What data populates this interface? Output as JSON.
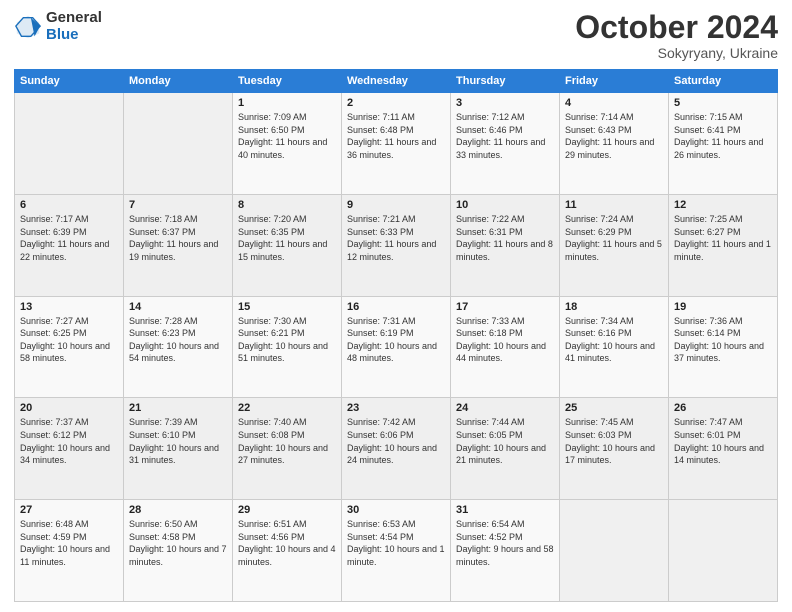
{
  "logo": {
    "general": "General",
    "blue": "Blue"
  },
  "header": {
    "month": "October 2024",
    "location": "Sokyryany, Ukraine"
  },
  "weekdays": [
    "Sunday",
    "Monday",
    "Tuesday",
    "Wednesday",
    "Thursday",
    "Friday",
    "Saturday"
  ],
  "weeks": [
    [
      {
        "day": null,
        "info": null
      },
      {
        "day": null,
        "info": null
      },
      {
        "day": "1",
        "info": "Sunrise: 7:09 AM\nSunset: 6:50 PM\nDaylight: 11 hours and 40 minutes."
      },
      {
        "day": "2",
        "info": "Sunrise: 7:11 AM\nSunset: 6:48 PM\nDaylight: 11 hours and 36 minutes."
      },
      {
        "day": "3",
        "info": "Sunrise: 7:12 AM\nSunset: 6:46 PM\nDaylight: 11 hours and 33 minutes."
      },
      {
        "day": "4",
        "info": "Sunrise: 7:14 AM\nSunset: 6:43 PM\nDaylight: 11 hours and 29 minutes."
      },
      {
        "day": "5",
        "info": "Sunrise: 7:15 AM\nSunset: 6:41 PM\nDaylight: 11 hours and 26 minutes."
      }
    ],
    [
      {
        "day": "6",
        "info": "Sunrise: 7:17 AM\nSunset: 6:39 PM\nDaylight: 11 hours and 22 minutes."
      },
      {
        "day": "7",
        "info": "Sunrise: 7:18 AM\nSunset: 6:37 PM\nDaylight: 11 hours and 19 minutes."
      },
      {
        "day": "8",
        "info": "Sunrise: 7:20 AM\nSunset: 6:35 PM\nDaylight: 11 hours and 15 minutes."
      },
      {
        "day": "9",
        "info": "Sunrise: 7:21 AM\nSunset: 6:33 PM\nDaylight: 11 hours and 12 minutes."
      },
      {
        "day": "10",
        "info": "Sunrise: 7:22 AM\nSunset: 6:31 PM\nDaylight: 11 hours and 8 minutes."
      },
      {
        "day": "11",
        "info": "Sunrise: 7:24 AM\nSunset: 6:29 PM\nDaylight: 11 hours and 5 minutes."
      },
      {
        "day": "12",
        "info": "Sunrise: 7:25 AM\nSunset: 6:27 PM\nDaylight: 11 hours and 1 minute."
      }
    ],
    [
      {
        "day": "13",
        "info": "Sunrise: 7:27 AM\nSunset: 6:25 PM\nDaylight: 10 hours and 58 minutes."
      },
      {
        "day": "14",
        "info": "Sunrise: 7:28 AM\nSunset: 6:23 PM\nDaylight: 10 hours and 54 minutes."
      },
      {
        "day": "15",
        "info": "Sunrise: 7:30 AM\nSunset: 6:21 PM\nDaylight: 10 hours and 51 minutes."
      },
      {
        "day": "16",
        "info": "Sunrise: 7:31 AM\nSunset: 6:19 PM\nDaylight: 10 hours and 48 minutes."
      },
      {
        "day": "17",
        "info": "Sunrise: 7:33 AM\nSunset: 6:18 PM\nDaylight: 10 hours and 44 minutes."
      },
      {
        "day": "18",
        "info": "Sunrise: 7:34 AM\nSunset: 6:16 PM\nDaylight: 10 hours and 41 minutes."
      },
      {
        "day": "19",
        "info": "Sunrise: 7:36 AM\nSunset: 6:14 PM\nDaylight: 10 hours and 37 minutes."
      }
    ],
    [
      {
        "day": "20",
        "info": "Sunrise: 7:37 AM\nSunset: 6:12 PM\nDaylight: 10 hours and 34 minutes."
      },
      {
        "day": "21",
        "info": "Sunrise: 7:39 AM\nSunset: 6:10 PM\nDaylight: 10 hours and 31 minutes."
      },
      {
        "day": "22",
        "info": "Sunrise: 7:40 AM\nSunset: 6:08 PM\nDaylight: 10 hours and 27 minutes."
      },
      {
        "day": "23",
        "info": "Sunrise: 7:42 AM\nSunset: 6:06 PM\nDaylight: 10 hours and 24 minutes."
      },
      {
        "day": "24",
        "info": "Sunrise: 7:44 AM\nSunset: 6:05 PM\nDaylight: 10 hours and 21 minutes."
      },
      {
        "day": "25",
        "info": "Sunrise: 7:45 AM\nSunset: 6:03 PM\nDaylight: 10 hours and 17 minutes."
      },
      {
        "day": "26",
        "info": "Sunrise: 7:47 AM\nSunset: 6:01 PM\nDaylight: 10 hours and 14 minutes."
      }
    ],
    [
      {
        "day": "27",
        "info": "Sunrise: 6:48 AM\nSunset: 4:59 PM\nDaylight: 10 hours and 11 minutes."
      },
      {
        "day": "28",
        "info": "Sunrise: 6:50 AM\nSunset: 4:58 PM\nDaylight: 10 hours and 7 minutes."
      },
      {
        "day": "29",
        "info": "Sunrise: 6:51 AM\nSunset: 4:56 PM\nDaylight: 10 hours and 4 minutes."
      },
      {
        "day": "30",
        "info": "Sunrise: 6:53 AM\nSunset: 4:54 PM\nDaylight: 10 hours and 1 minute."
      },
      {
        "day": "31",
        "info": "Sunrise: 6:54 AM\nSunset: 4:52 PM\nDaylight: 9 hours and 58 minutes."
      },
      {
        "day": null,
        "info": null
      },
      {
        "day": null,
        "info": null
      }
    ]
  ]
}
